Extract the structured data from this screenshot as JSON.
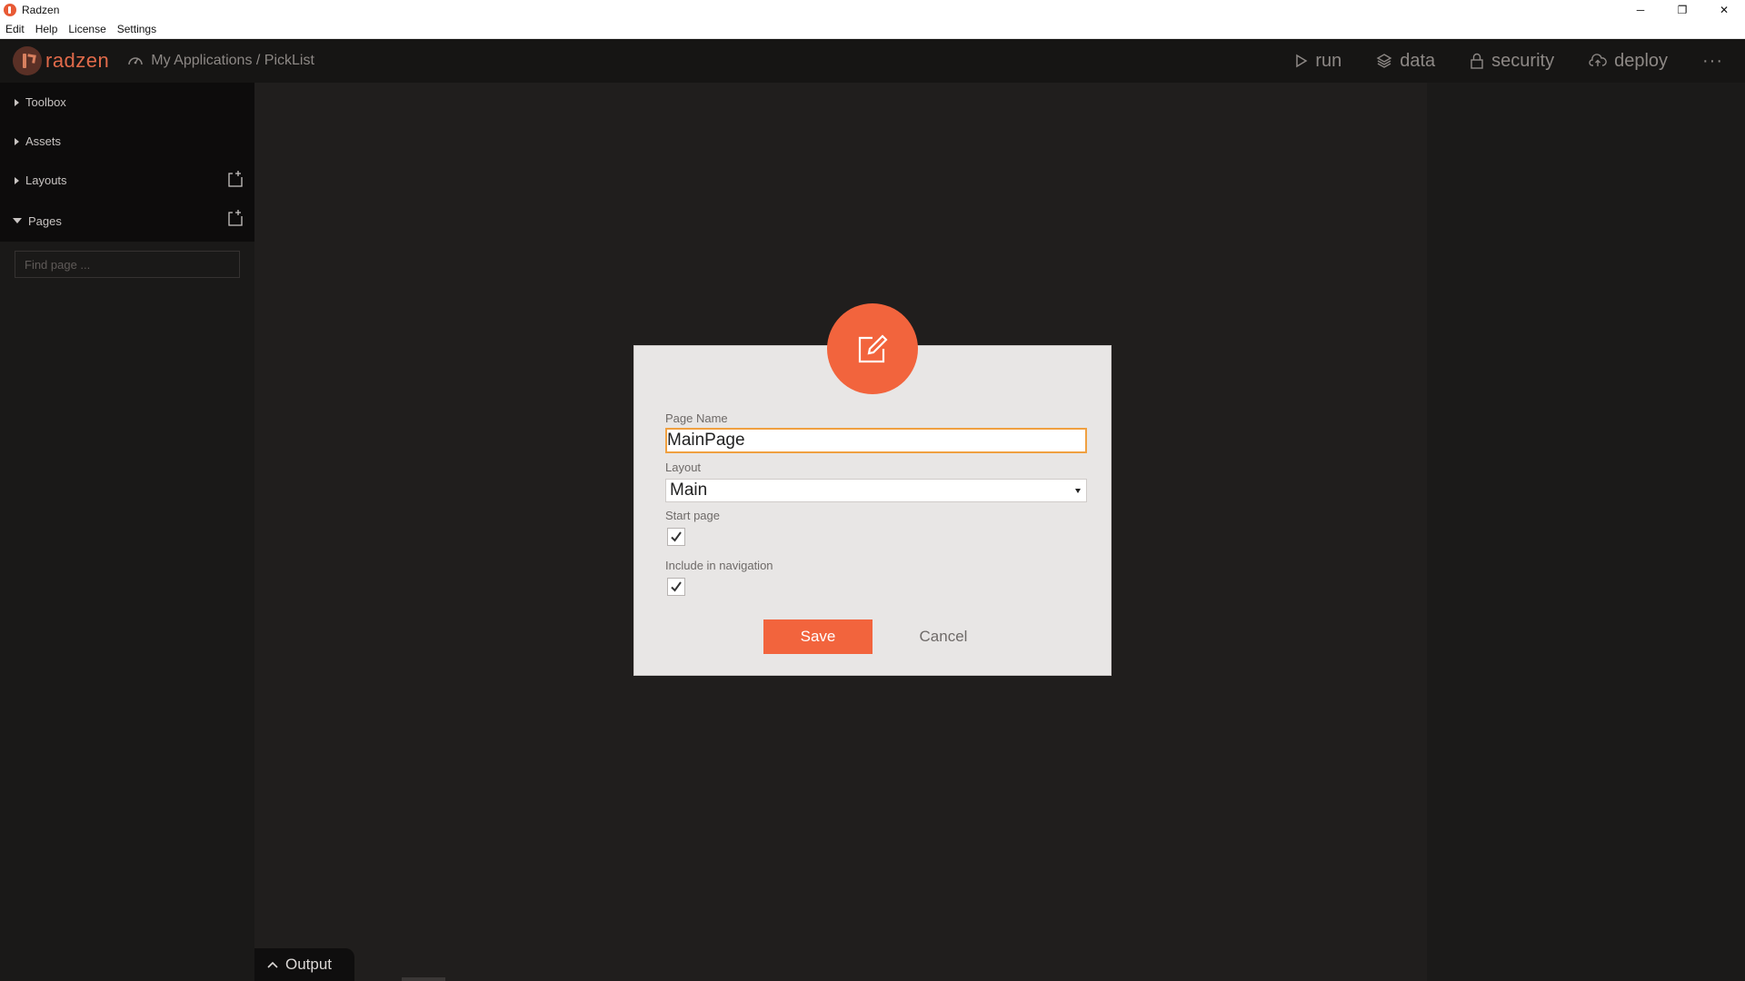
{
  "window": {
    "title": "Radzen",
    "controls": {
      "minimize": "─",
      "restore": "❐",
      "close": "✕"
    }
  },
  "menu": [
    "Edit",
    "Help",
    "License",
    "Settings"
  ],
  "header": {
    "brand": "radzen",
    "breadcrumb": "My Applications / PickList",
    "nav": {
      "run": "run",
      "data": "data",
      "security": "security",
      "deploy": "deploy",
      "more": "···"
    }
  },
  "sidebar": {
    "sections": {
      "toolbox": "Toolbox",
      "assets": "Assets",
      "layouts": "Layouts",
      "pages": "Pages"
    },
    "find_placeholder": "Find page ..."
  },
  "dialog": {
    "page_name_label": "Page Name",
    "page_name_value": "MainPage",
    "layout_label": "Layout",
    "layout_value": "Main",
    "start_page_label": "Start page",
    "start_page_checked": true,
    "include_nav_label": "Include in navigation",
    "include_nav_checked": true,
    "save_label": "Save",
    "cancel_label": "Cancel"
  },
  "output": {
    "label": "Output"
  },
  "colors": {
    "accent": "#f2643d",
    "input_focus": "#f0a040",
    "header_bg": "#161514",
    "canvas_bg": "#201e1d"
  }
}
